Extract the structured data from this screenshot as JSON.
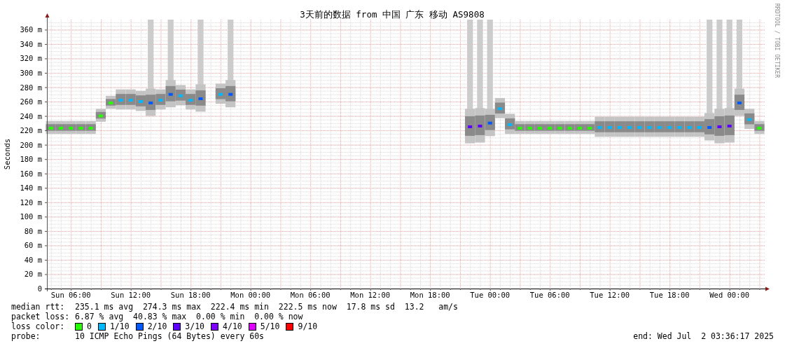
{
  "graph": {
    "credit": "RRDTOOL / TOBI OETIKER",
    "chart_data": {
      "type": "scatter",
      "title": "3天前的数据 from 中国 广东 移动 AS9808",
      "ylabel": "Seconds",
      "categories": [
        null,
        null,
        "Sun 06:00",
        null,
        null,
        null,
        null,
        null,
        "Sun 12:00",
        null,
        null,
        null,
        null,
        null,
        "Sun 18:00",
        null,
        null,
        null,
        null,
        null,
        "Mon 00:00",
        null,
        null,
        null,
        null,
        null,
        "Mon 06:00",
        null,
        null,
        null,
        null,
        null,
        "Mon 12:00",
        null,
        null,
        null,
        null,
        null,
        "Mon 18:00",
        null,
        null,
        null,
        null,
        null,
        "Tue 00:00",
        null,
        null,
        null,
        null,
        null,
        "Tue 06:00",
        null,
        null,
        null,
        null,
        null,
        "Tue 12:00",
        null,
        null,
        null,
        null,
        null,
        "Tue 18:00",
        null,
        null,
        null,
        null,
        null,
        "Wed 00:00",
        null,
        null,
        null
      ],
      "ylim": [
        0,
        374
      ],
      "grid": true,
      "yticks": [
        {
          "value": 0,
          "label": "0"
        },
        {
          "value": 20,
          "label": "20 m"
        },
        {
          "value": 40,
          "label": "40 m"
        },
        {
          "value": 60,
          "label": "60 m"
        },
        {
          "value": 80,
          "label": "80 m"
        },
        {
          "value": 100,
          "label": "100 m"
        },
        {
          "value": 120,
          "label": "120 m"
        },
        {
          "value": 140,
          "label": "140 m"
        },
        {
          "value": 160,
          "label": "160 m"
        },
        {
          "value": 180,
          "label": "180 m"
        },
        {
          "value": 200,
          "label": "200 m"
        },
        {
          "value": 220,
          "label": "220 m"
        },
        {
          "value": 240,
          "label": "240 m"
        },
        {
          "value": 260,
          "label": "260 m"
        },
        {
          "value": 280,
          "label": "280 m"
        },
        {
          "value": 300,
          "label": "300 m"
        },
        {
          "value": 320,
          "label": "320 m"
        },
        {
          "value": 340,
          "label": "340 m"
        },
        {
          "value": 360,
          "label": "360 m"
        }
      ],
      "series": [
        {
          "name": "0",
          "color": "#26ff00",
          "marker": "square",
          "values": [
            223,
            223,
            223,
            223,
            223,
            240,
            258,
            null,
            null,
            null,
            null,
            null,
            null,
            null,
            null,
            null,
            null,
            null,
            null,
            null,
            null,
            null,
            null,
            null,
            null,
            null,
            null,
            null,
            null,
            null,
            null,
            null,
            null,
            null,
            null,
            null,
            null,
            null,
            null,
            null,
            null,
            null,
            null,
            null,
            null,
            null,
            null,
            223,
            223,
            223,
            223,
            223,
            223,
            223,
            223,
            null,
            null,
            null,
            null,
            null,
            null,
            null,
            null,
            null,
            null,
            null,
            null,
            null,
            null,
            null,
            null,
            223
          ]
        },
        {
          "name": "1/10",
          "color": "#00b8ff",
          "marker": "square",
          "values": [
            null,
            null,
            null,
            null,
            null,
            null,
            null,
            262,
            262,
            260,
            null,
            262,
            null,
            268,
            262,
            null,
            null,
            270,
            null,
            null,
            null,
            null,
            null,
            null,
            null,
            null,
            null,
            null,
            null,
            null,
            null,
            null,
            null,
            null,
            null,
            null,
            null,
            null,
            null,
            null,
            null,
            null,
            null,
            null,
            null,
            250,
            228,
            null,
            null,
            null,
            null,
            null,
            null,
            null,
            null,
            224,
            224,
            224,
            224,
            224,
            224,
            224,
            224,
            224,
            224,
            224,
            null,
            null,
            null,
            null,
            235,
            null
          ]
        },
        {
          "name": "2/10",
          "color": "#0059ff",
          "marker": "square",
          "values": [
            null,
            null,
            null,
            null,
            null,
            null,
            null,
            null,
            null,
            null,
            258,
            null,
            270,
            null,
            null,
            264,
            null,
            null,
            270,
            null,
            null,
            null,
            null,
            null,
            null,
            null,
            null,
            null,
            null,
            null,
            null,
            null,
            null,
            null,
            null,
            null,
            null,
            null,
            null,
            null,
            null,
            null,
            null,
            null,
            230,
            null,
            null,
            null,
            null,
            null,
            null,
            null,
            null,
            null,
            null,
            null,
            null,
            null,
            null,
            null,
            null,
            null,
            null,
            null,
            null,
            null,
            224,
            null,
            null,
            258,
            null,
            null
          ]
        },
        {
          "name": "3/10",
          "color": "#5e00ff",
          "marker": "square",
          "values": [
            null,
            null,
            null,
            null,
            null,
            null,
            null,
            null,
            null,
            null,
            null,
            null,
            null,
            null,
            null,
            null,
            null,
            null,
            null,
            null,
            null,
            null,
            null,
            null,
            null,
            null,
            null,
            null,
            null,
            null,
            null,
            null,
            null,
            null,
            null,
            null,
            null,
            null,
            null,
            null,
            null,
            null,
            225,
            226,
            null,
            null,
            null,
            null,
            null,
            null,
            null,
            null,
            null,
            null,
            null,
            null,
            null,
            null,
            null,
            null,
            null,
            null,
            null,
            null,
            null,
            null,
            null,
            225,
            226,
            null,
            null,
            null
          ]
        },
        {
          "name": "4/10",
          "color": "#7e00ff",
          "values": [
            null,
            null,
            null,
            null,
            null,
            null,
            null,
            null,
            null,
            null,
            null,
            null,
            null,
            null,
            null,
            null,
            null,
            null,
            null,
            null,
            null,
            null,
            null,
            null,
            null,
            null,
            null,
            null,
            null,
            null,
            null,
            null,
            null,
            null,
            null,
            null,
            null,
            null,
            null,
            null,
            null,
            null,
            null,
            null,
            null,
            null,
            null,
            null,
            null,
            null,
            null,
            null,
            null,
            null,
            null,
            null,
            null,
            null,
            null,
            null,
            null,
            null,
            null,
            null,
            null,
            null,
            null,
            null,
            null,
            null,
            null,
            null
          ]
        },
        {
          "name": "5/10",
          "color": "#dd00ff",
          "values": [
            null,
            null,
            null,
            null,
            null,
            null,
            null,
            null,
            null,
            null,
            null,
            null,
            null,
            null,
            null,
            null,
            null,
            null,
            null,
            null,
            null,
            null,
            null,
            null,
            null,
            null,
            null,
            null,
            null,
            null,
            null,
            null,
            null,
            null,
            null,
            null,
            null,
            null,
            null,
            null,
            null,
            null,
            null,
            null,
            null,
            null,
            null,
            null,
            null,
            null,
            null,
            null,
            null,
            null,
            null,
            null,
            null,
            null,
            null,
            null,
            null,
            null,
            null,
            null,
            null,
            null,
            null,
            null,
            null,
            null,
            null,
            null
          ]
        },
        {
          "name": "9/10",
          "color": "#ff0000",
          "values": [
            null,
            null,
            null,
            null,
            null,
            null,
            null,
            null,
            null,
            null,
            null,
            null,
            null,
            null,
            null,
            null,
            null,
            null,
            null,
            null,
            null,
            null,
            null,
            null,
            null,
            null,
            null,
            null,
            null,
            null,
            null,
            null,
            null,
            null,
            null,
            null,
            null,
            null,
            null,
            null,
            null,
            null,
            null,
            null,
            null,
            null,
            null,
            null,
            null,
            null,
            null,
            null,
            null,
            null,
            null,
            null,
            null,
            null,
            null,
            null,
            null,
            null,
            null,
            null,
            null,
            null,
            null,
            null,
            null,
            null,
            null,
            null
          ]
        }
      ]
    }
  },
  "stats": [
    {
      "label": "median rtt:",
      "value": "235.1 ms avg  274.3 ms max  222.4 ms min  222.5 ms now  17.8 ms sd  13.2   am/s"
    },
    {
      "label": "packet loss:",
      "value": "6.87 % avg  40.83 % max  0.00 % min  0.00 % now"
    }
  ],
  "loss_color": {
    "label": "loss color:"
  },
  "probe": {
    "label": "probe:",
    "value": "10 ICMP Echo Pings (64 Bytes) every 60s"
  },
  "end": "end: Wed Jul  2 03:36:17 2025"
}
